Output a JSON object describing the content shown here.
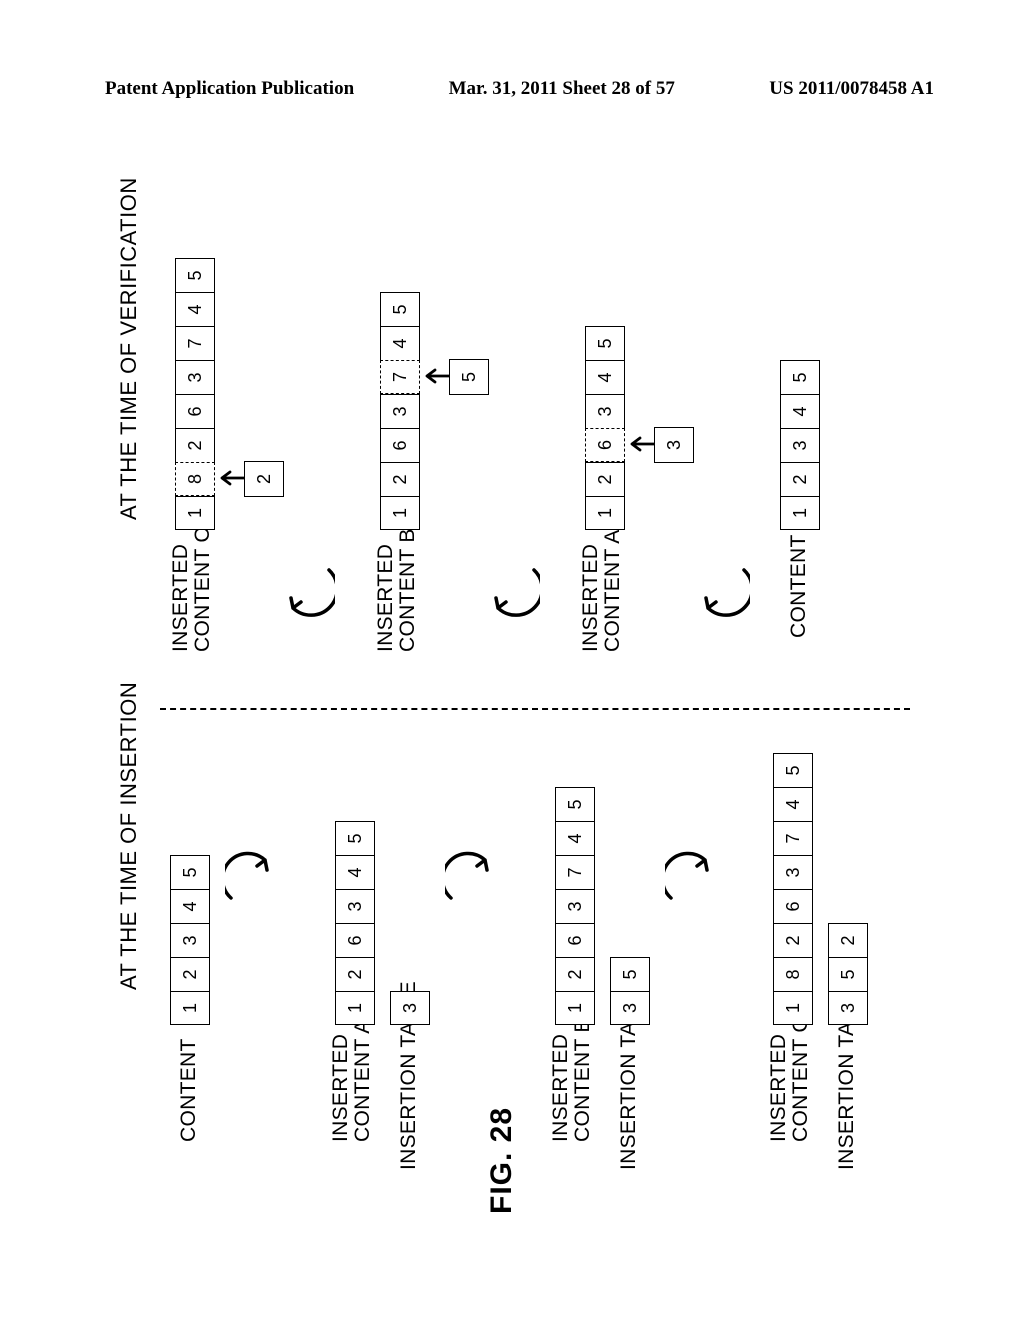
{
  "header": {
    "left": "Patent Application Publication",
    "center": "Mar. 31, 2011  Sheet 28 of 57",
    "right": "US 2011/0078458 A1"
  },
  "figure_label": "FIG. 28",
  "left_title": "AT THE TIME OF INSERTION",
  "right_title": "AT THE TIME OF VERIFICATION",
  "labels": {
    "content": "CONTENT",
    "inserted_a": "INSERTED\nCONTENT A",
    "inserted_b": "INSERTED\nCONTENT B",
    "inserted_c": "INSERTED\nCONTENT C",
    "insertion_table": "INSERTION TABLE"
  },
  "left": {
    "content": [
      "1",
      "2",
      "3",
      "4",
      "5"
    ],
    "row_a": [
      "1",
      "2",
      "6",
      "3",
      "4",
      "5"
    ],
    "row_a_tbl": [
      "3"
    ],
    "row_b": [
      "1",
      "2",
      "6",
      "3",
      "7",
      "4",
      "5"
    ],
    "row_b_tbl": [
      "3",
      "5"
    ],
    "row_c": [
      "1",
      "8",
      "2",
      "6",
      "3",
      "7",
      "4",
      "5"
    ],
    "row_c_tbl": [
      "3",
      "5",
      "2"
    ]
  },
  "right": {
    "row_c": [
      "1",
      "8",
      "2",
      "6",
      "3",
      "7",
      "4",
      "5"
    ],
    "row_c_dashed_index": 1,
    "row_c_under": "2",
    "row_b": [
      "1",
      "2",
      "6",
      "3",
      "7",
      "4",
      "5"
    ],
    "row_b_dashed_index": 4,
    "row_b_under": "5",
    "row_a": [
      "1",
      "2",
      "6",
      "3",
      "4",
      "5"
    ],
    "row_a_dashed_index": 2,
    "row_a_under": "3",
    "content": [
      "1",
      "2",
      "3",
      "4",
      "5"
    ]
  }
}
